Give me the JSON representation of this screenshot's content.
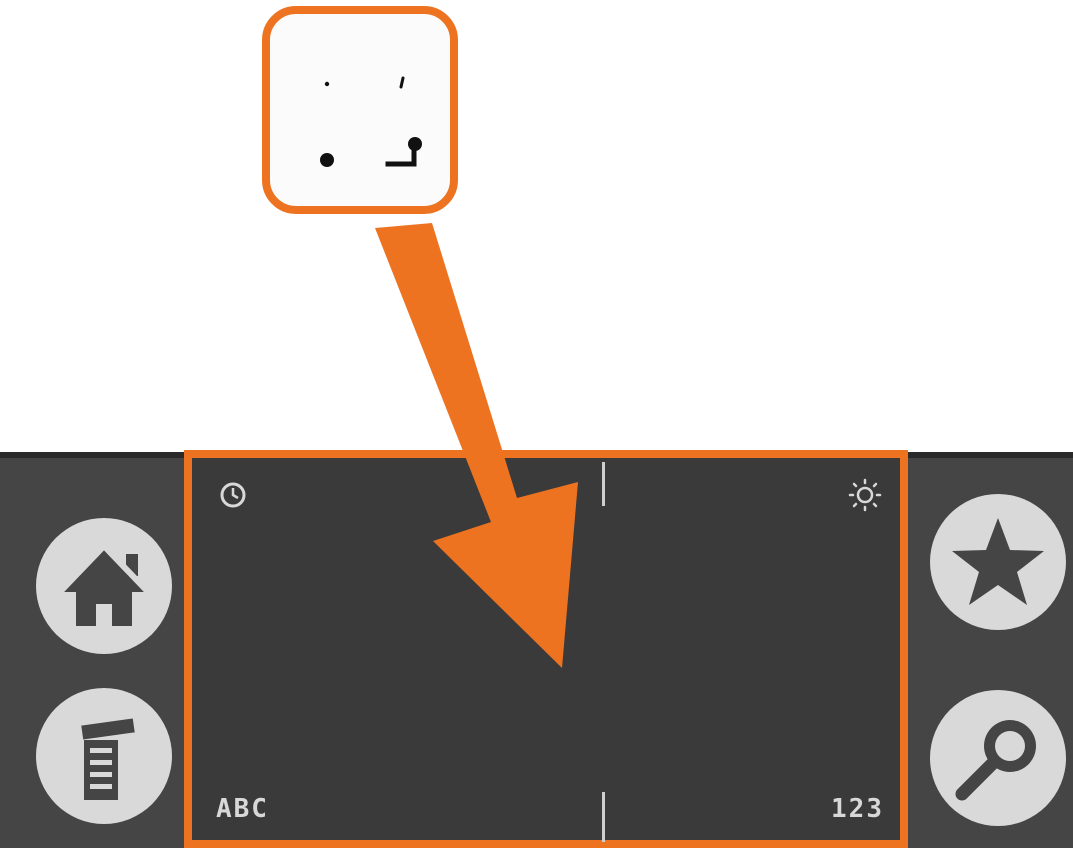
{
  "graffiti_area": {
    "left_label": "ABC",
    "right_label": "123"
  },
  "icons": {
    "home": "home-icon",
    "menu": "menu-icon",
    "favorites": "star-icon",
    "find": "search-icon",
    "clock": "clock-icon",
    "brightness": "brightness-icon",
    "pointer": "arrow-icon"
  },
  "colors": {
    "highlight": "#ee7320",
    "device_body": "#454545",
    "writing_area": "#3a3a3a",
    "button": "#d9d9d9"
  }
}
